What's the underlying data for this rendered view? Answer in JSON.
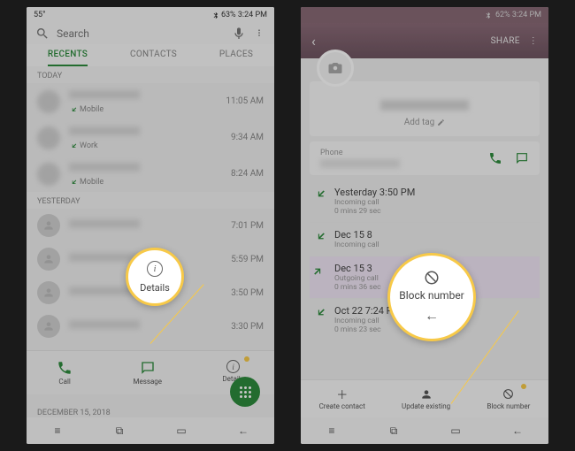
{
  "left": {
    "status": {
      "left": "55°",
      "right": "63% 3:24 PM"
    },
    "search": {
      "placeholder": "Search"
    },
    "tabs": [
      "RECENTS",
      "CONTACTS",
      "PLACES"
    ],
    "sections": [
      {
        "label": "TODAY",
        "calls": [
          {
            "type": "Mobile",
            "time": "11:05 AM",
            "hasIcon": true
          },
          {
            "type": "Work",
            "time": "9:34 AM",
            "hasIcon": true
          },
          {
            "type": "Mobile",
            "time": "8:24 AM",
            "hasIcon": true
          }
        ]
      },
      {
        "label": "YESTERDAY",
        "calls": [
          {
            "type": "",
            "time": "7:01 PM"
          },
          {
            "type": "",
            "time": "5:59 PM"
          },
          {
            "type": "",
            "time": "3:50 PM"
          },
          {
            "type": "",
            "time": "3:30 PM"
          }
        ]
      }
    ],
    "actions": [
      {
        "label": "Call"
      },
      {
        "label": "Message"
      },
      {
        "label": "Details"
      }
    ],
    "callout_label": "Details",
    "date_footer": "DECEMBER 15, 2018"
  },
  "right": {
    "status": {
      "right": "62% 3:24 PM"
    },
    "share": "SHARE",
    "addtag": "Add tag",
    "phone_label": "Phone",
    "log": [
      {
        "title": "Yesterday 3:50 PM",
        "sub": "Incoming call",
        "dur": "0 mins 29 sec"
      },
      {
        "title": "Dec 15 8",
        "sub": "Incoming call",
        "dur": ""
      },
      {
        "title": "Dec 15 3",
        "sub": "Outgoing call",
        "dur": "0 mins 36 sec",
        "hilite": true
      },
      {
        "title": "Oct 22 7:24 PM",
        "sub": "Incoming call",
        "dur": "0 mins 23 sec"
      }
    ],
    "bottom_actions": [
      {
        "label": "Create contact"
      },
      {
        "label": "Update existing"
      },
      {
        "label": "Block number"
      }
    ],
    "callout_label": "Block number"
  }
}
